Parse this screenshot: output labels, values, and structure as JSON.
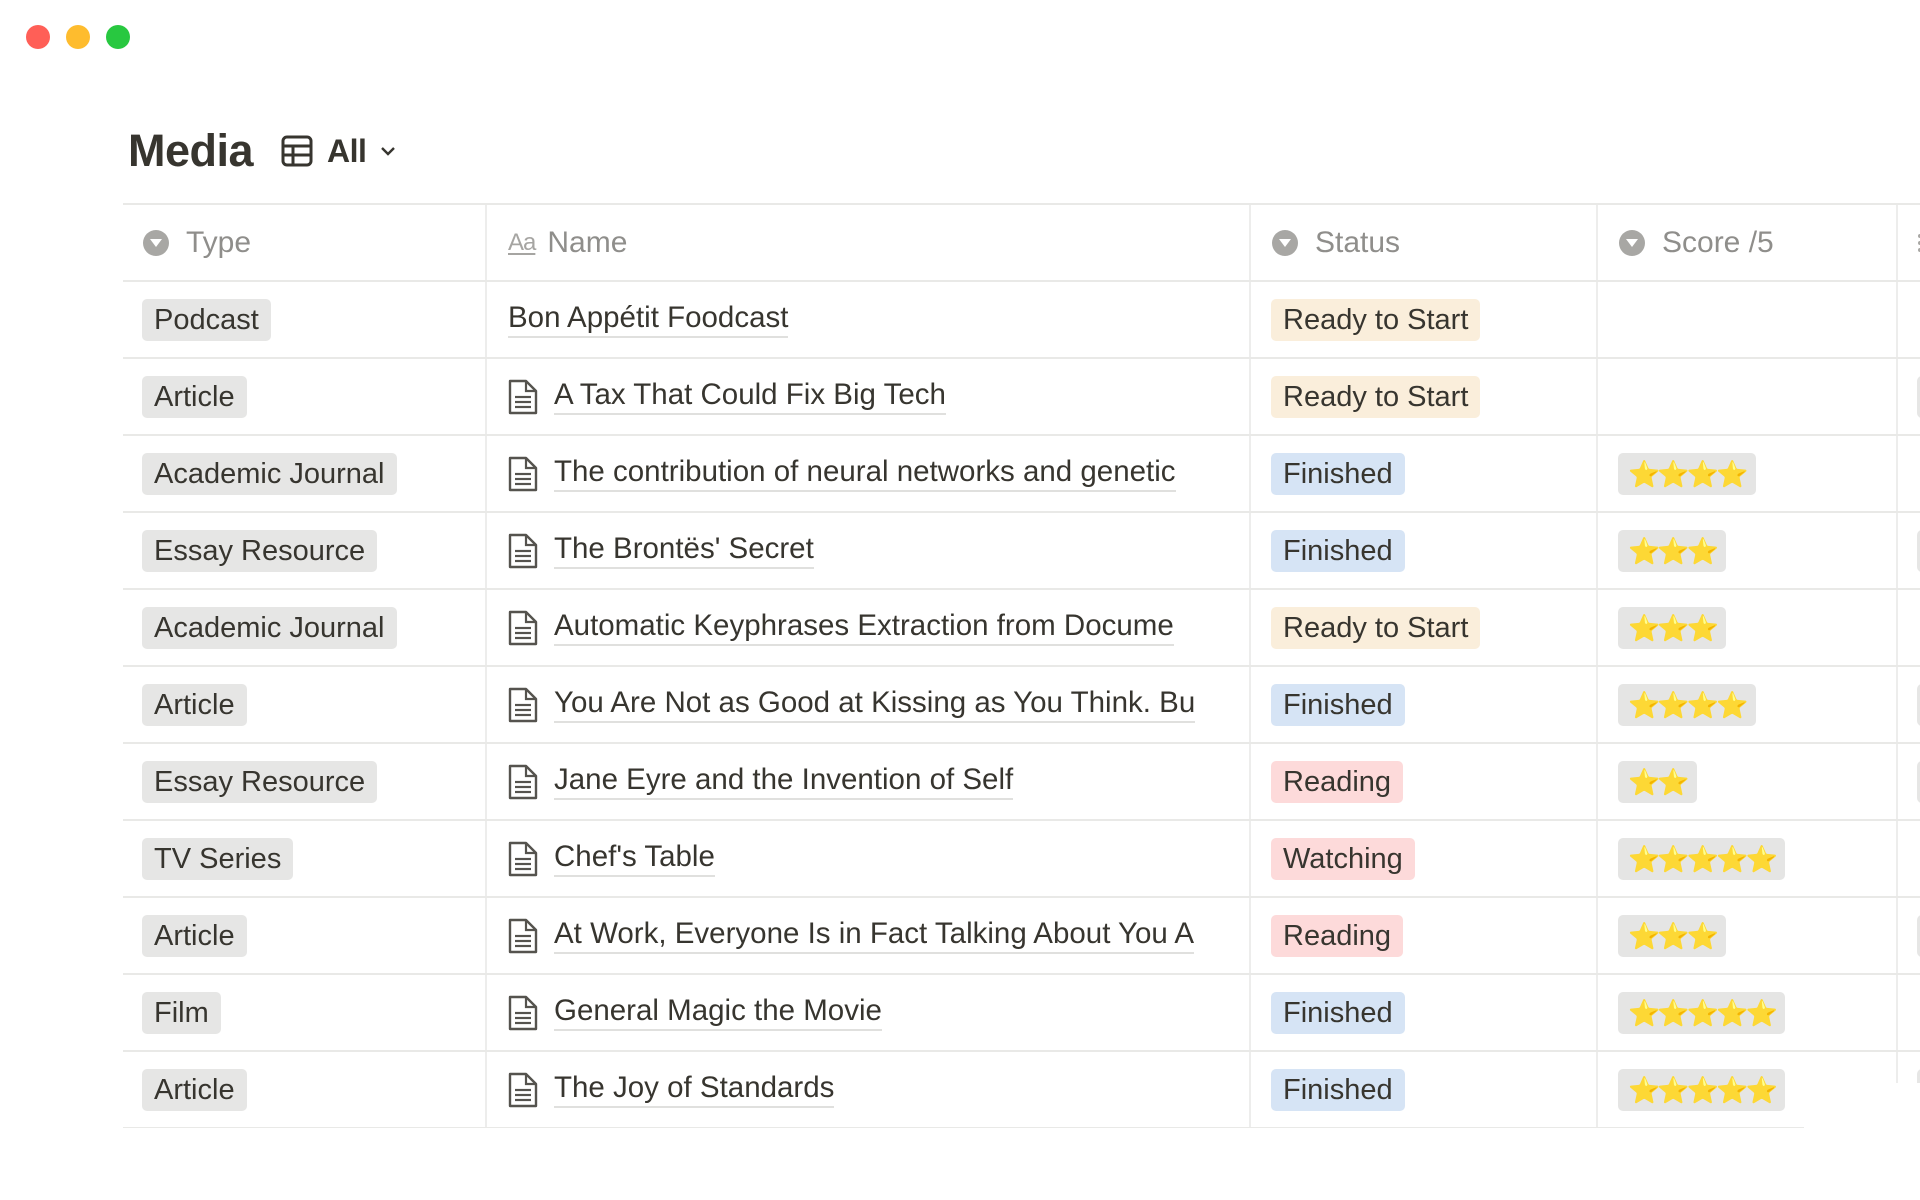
{
  "window": {
    "controls": [
      "close",
      "minimize",
      "maximize"
    ]
  },
  "header": {
    "title": "Media",
    "view_icon": "table-icon",
    "view_label": "All",
    "view_chevron": "chevron-down-icon"
  },
  "table": {
    "columns": [
      {
        "label": "Type",
        "icon": "select-icon"
      },
      {
        "label": "Name",
        "icon": "title-aa-icon",
        "icon_text": "Aa"
      },
      {
        "label": "Status",
        "icon": "select-icon"
      },
      {
        "label": "Score /5",
        "icon": "select-icon"
      },
      {
        "label": "",
        "icon": "multi-select-list-icon"
      }
    ],
    "rows": [
      {
        "type": "Podcast",
        "name": "Bon Appétit Foodcast",
        "has_doc_icon": false,
        "status": "Ready to Start",
        "status_color": "#FAEEDB",
        "score": "",
        "extra_pill": false
      },
      {
        "type": "Article",
        "name": "A Tax That Could Fix Big Tech",
        "has_doc_icon": true,
        "status": "Ready to Start",
        "status_color": "#FAEEDB",
        "score": "",
        "extra_pill": true
      },
      {
        "type": "Academic Journal",
        "name": "The contribution of neural networks and genetic",
        "has_doc_icon": true,
        "status": "Finished",
        "status_color": "#D6E4F5",
        "score": "⭐⭐⭐⭐",
        "extra_pill": false
      },
      {
        "type": "Essay Resource",
        "name": "The Brontës' Secret",
        "has_doc_icon": true,
        "status": "Finished",
        "status_color": "#D6E4F5",
        "score": "⭐⭐⭐",
        "extra_pill": true
      },
      {
        "type": "Academic Journal",
        "name": "Automatic Keyphrases Extraction from Docume",
        "has_doc_icon": true,
        "status": "Ready to Start",
        "status_color": "#FAEEDB",
        "score": "⭐⭐⭐",
        "extra_pill": false
      },
      {
        "type": "Article",
        "name": "You Are Not as Good at Kissing as You Think. Bu",
        "has_doc_icon": true,
        "status": "Finished",
        "status_color": "#D6E4F5",
        "score": "⭐⭐⭐⭐",
        "extra_pill": true
      },
      {
        "type": "Essay Resource",
        "name": "Jane Eyre and the Invention of Self",
        "has_doc_icon": true,
        "status": "Reading",
        "status_color": "#FDDADA",
        "score": "⭐⭐",
        "extra_pill": true
      },
      {
        "type": "TV Series",
        "name": "Chef's Table",
        "has_doc_icon": true,
        "status": "Watching",
        "status_color": "#FDDADA",
        "score": "⭐⭐⭐⭐⭐",
        "extra_pill": false
      },
      {
        "type": "Article",
        "name": "At Work, Everyone Is in Fact Talking About You A",
        "has_doc_icon": true,
        "status": "Reading",
        "status_color": "#FDDADA",
        "score": "⭐⭐⭐",
        "extra_pill": true
      },
      {
        "type": "Film",
        "name": "General Magic the Movie",
        "has_doc_icon": true,
        "status": "Finished",
        "status_color": "#D6E4F5",
        "score": "⭐⭐⭐⭐⭐",
        "extra_pill": false
      },
      {
        "type": "Article",
        "name": "The Joy of Standards",
        "has_doc_icon": true,
        "status": "Finished",
        "status_color": "#D6E4F5",
        "score": "⭐⭐⭐⭐⭐",
        "extra_pill": true
      }
    ]
  },
  "colors": {
    "type_pill": "#E6E6E5",
    "ready": "#FAEEDB",
    "finished": "#D6E4F5",
    "reading": "#FDDADA",
    "text": "#37352F",
    "header_text": "#8F8E8B"
  }
}
